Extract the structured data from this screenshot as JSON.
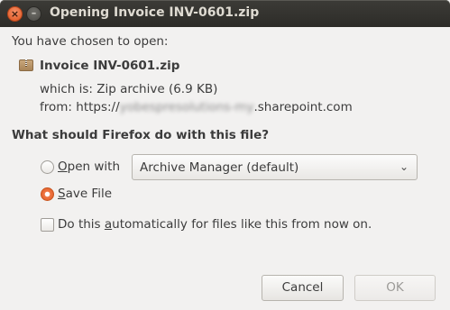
{
  "window": {
    "title": "Opening Invoice INV-0601.zip"
  },
  "intro": "You have chosen to open:",
  "file": {
    "name": "Invoice INV-0601.zip",
    "which_is_label": "which is:",
    "type": "Zip archive (6.9 KB)",
    "from_label": "from:",
    "from_prefix": "https://",
    "from_blurred": "yobespresolutions-my",
    "from_suffix": ".sharepoint.com"
  },
  "question": "What should Firefox do with this file?",
  "open_with": {
    "label_key": "O",
    "label_rest": "pen with",
    "application": "Archive Manager (default)"
  },
  "save_file": {
    "label_key": "S",
    "label_rest": "ave File"
  },
  "auto": {
    "label_pre": "Do this ",
    "label_key": "a",
    "label_rest": "utomatically for files like this from now on."
  },
  "buttons": {
    "cancel": "Cancel",
    "ok": "OK"
  }
}
